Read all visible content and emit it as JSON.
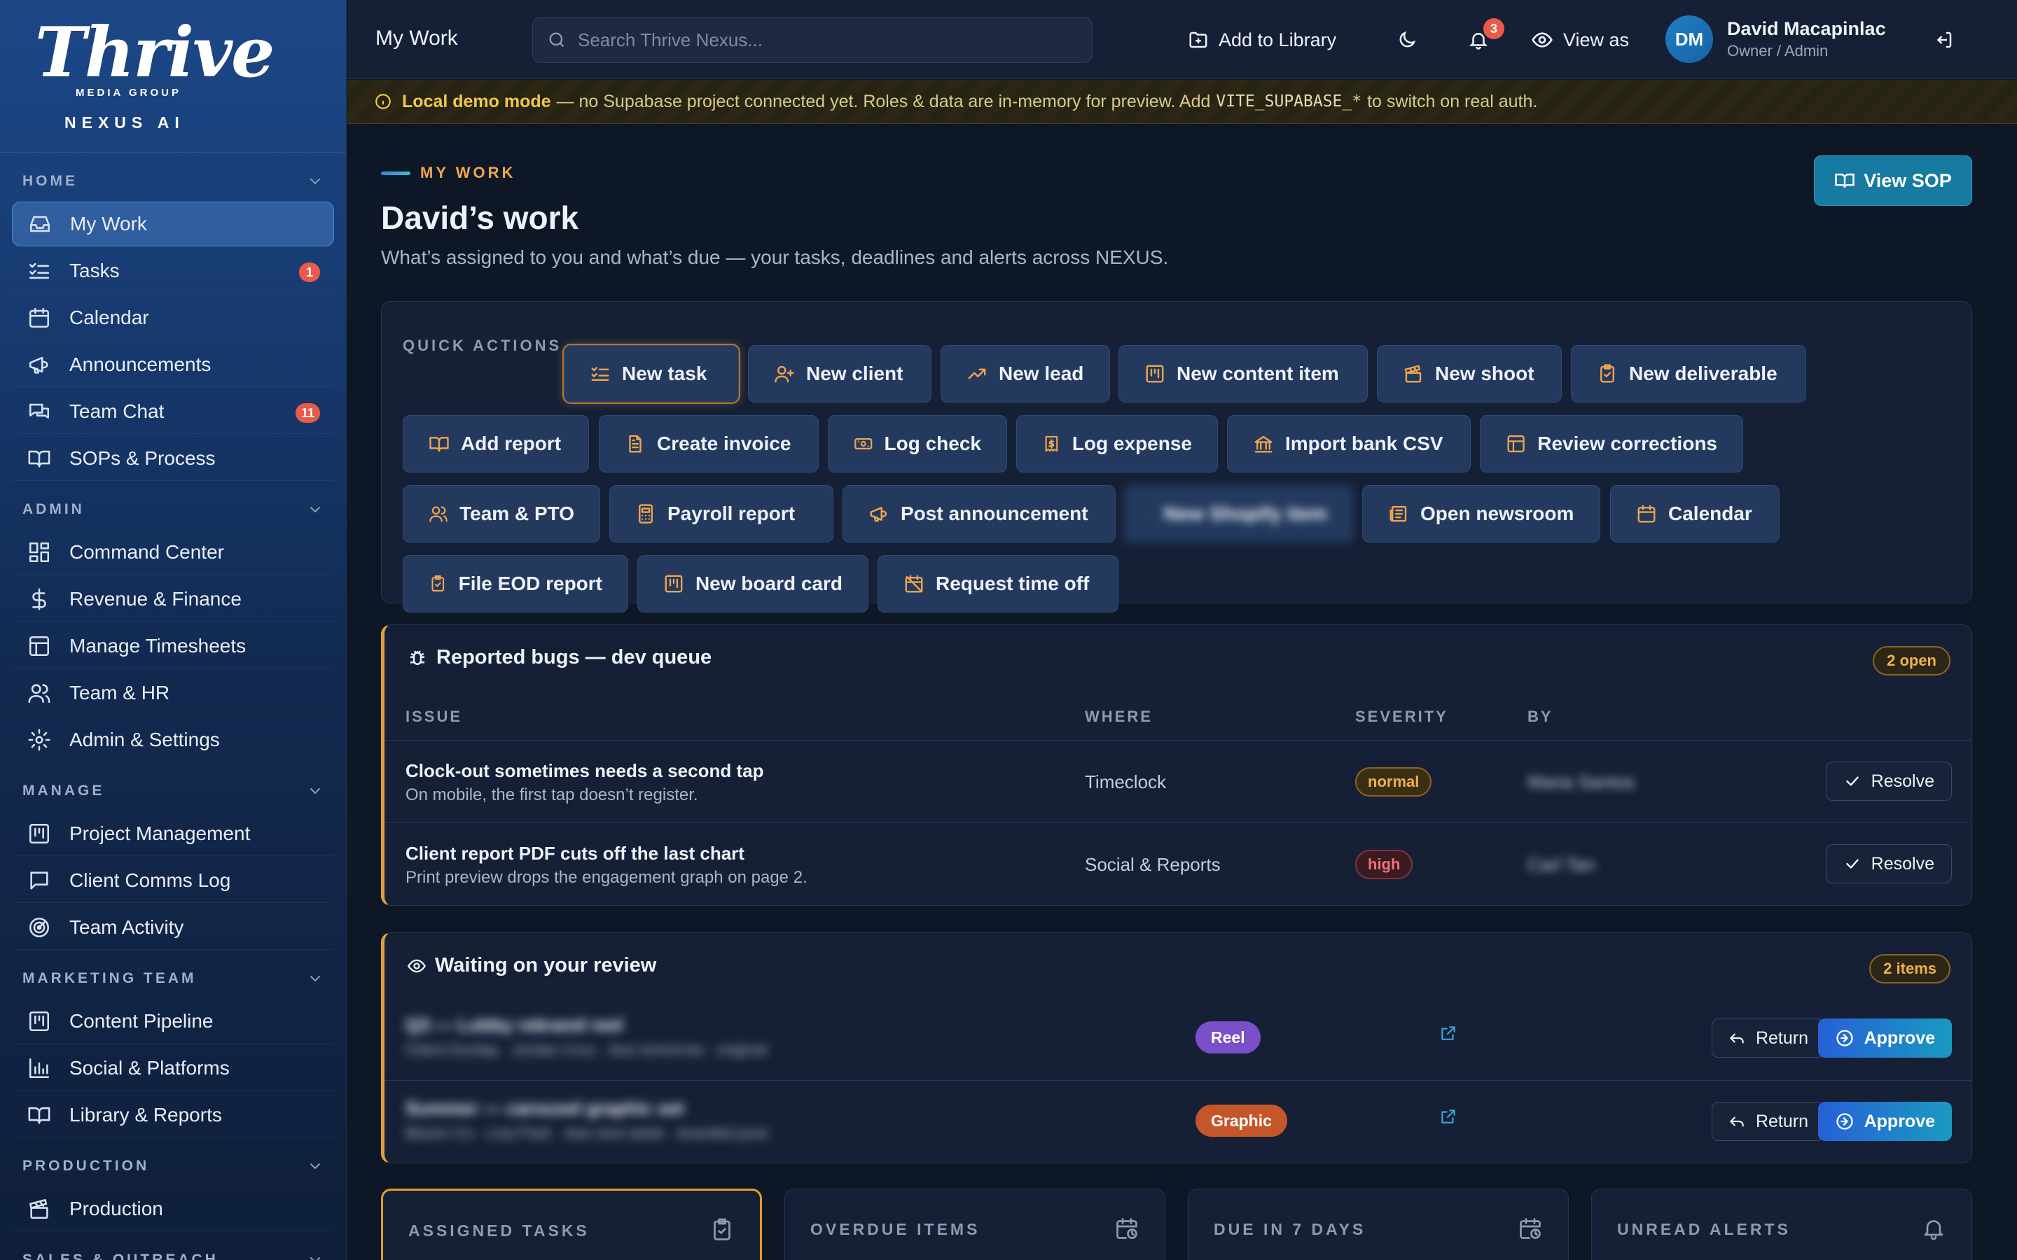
{
  "brand": {
    "script": "Thrive",
    "sub": "MEDIA GROUP",
    "product": "NEXUS AI"
  },
  "sidebar": {
    "sections": [
      {
        "label": "HOME",
        "items": [
          {
            "label": "My Work",
            "icon": "inbox-icon",
            "active": true
          },
          {
            "label": "Tasks",
            "icon": "list-check-icon",
            "badge": "1"
          },
          {
            "label": "Calendar",
            "icon": "calendar-icon"
          },
          {
            "label": "Announcements",
            "icon": "megaphone-icon"
          },
          {
            "label": "Team Chat",
            "icon": "chat-icon",
            "badge": "11"
          },
          {
            "label": "SOPs & Process",
            "icon": "book-icon"
          }
        ]
      },
      {
        "label": "ADMIN",
        "items": [
          {
            "label": "Command Center",
            "icon": "grid-icon"
          },
          {
            "label": "Revenue & Finance",
            "icon": "dollar-icon"
          },
          {
            "label": "Manage Timesheets",
            "icon": "table-icon"
          },
          {
            "label": "Team & HR",
            "icon": "users-icon"
          },
          {
            "label": "Admin & Settings",
            "icon": "gear-icon"
          }
        ]
      },
      {
        "label": "MANAGE",
        "items": [
          {
            "label": "Project Management",
            "icon": "kanban-icon"
          },
          {
            "label": "Client Comms Log",
            "icon": "message-square-icon"
          },
          {
            "label": "Team Activity",
            "icon": "radar-icon"
          }
        ]
      },
      {
        "label": "MARKETING TEAM",
        "items": [
          {
            "label": "Content Pipeline",
            "icon": "kanban-icon"
          },
          {
            "label": "Social & Platforms",
            "icon": "bar-chart-icon"
          },
          {
            "label": "Library & Reports",
            "icon": "book-icon"
          }
        ]
      },
      {
        "label": "PRODUCTION",
        "items": [
          {
            "label": "Production",
            "icon": "clapperboard-icon"
          }
        ]
      },
      {
        "label": "SALES & OUTREACH",
        "items": []
      }
    ]
  },
  "topbar": {
    "page": "My Work",
    "search_placeholder": "Search Thrive Nexus...",
    "add_library": "Add to Library",
    "notif_count": "3",
    "view_as": "View as",
    "user": {
      "initials": "DM",
      "name": "David Macapinlac",
      "role": "Owner / Admin"
    }
  },
  "banner": {
    "strong": "Local demo mode",
    "text": "— no Supabase project connected yet. Roles & data are in-memory for preview. Add",
    "code": "VITE_SUPABASE_*",
    "tail": "to switch on real auth."
  },
  "header": {
    "eyebrow": "MY WORK",
    "title": "David’s work",
    "subtitle": "What’s assigned to you and what’s due — your tasks, deadlines and alerts across NEXUS.",
    "sop_button": "View SOP"
  },
  "quick_actions": {
    "label": "QUICK ACTIONS",
    "items": [
      {
        "label": "New task",
        "icon": "list-check-icon"
      },
      {
        "label": "New client",
        "icon": "user-plus-icon"
      },
      {
        "label": "New lead",
        "icon": "trending-up-icon"
      },
      {
        "label": "New content item",
        "icon": "kanban-icon"
      },
      {
        "label": "New shoot",
        "icon": "clapperboard-icon"
      },
      {
        "label": "New deliverable",
        "icon": "clipboard-check-icon"
      },
      {
        "label": "Add report",
        "icon": "book-open-icon"
      },
      {
        "label": "Create invoice",
        "icon": "file-text-icon"
      },
      {
        "label": "Log check",
        "icon": "banknote-icon"
      },
      {
        "label": "Log expense",
        "icon": "receipt-dollar-icon"
      },
      {
        "label": "Import bank CSV",
        "icon": "bank-icon"
      },
      {
        "label": "Review corrections",
        "icon": "table-icon"
      },
      {
        "label": "Team & PTO",
        "icon": "users-icon"
      },
      {
        "label": "Payroll report",
        "icon": "calculator-icon"
      },
      {
        "label": "Post announcement",
        "icon": "megaphone-icon"
      },
      {
        "label": "New Shopify item",
        "icon": "circle-icon"
      },
      {
        "label": "Open newsroom",
        "icon": "newspaper-icon"
      },
      {
        "label": "Calendar",
        "icon": "calendar-icon"
      },
      {
        "label": "File EOD report",
        "icon": "clipboard-check-icon"
      },
      {
        "label": "New board card",
        "icon": "kanban-icon"
      },
      {
        "label": "Request time off",
        "icon": "calendar-off-icon"
      }
    ]
  },
  "bugs": {
    "title": "Reported bugs — dev queue",
    "count": "2 open",
    "columns": [
      "ISSUE",
      "WHERE",
      "SEVERITY",
      "BY"
    ],
    "rows": [
      {
        "title": "Clock-out sometimes needs a second tap",
        "desc": "On mobile, the first tap doesn’t register.",
        "where": "Timeclock",
        "severity": "normal",
        "by": "Maria Santos",
        "action": "Resolve"
      },
      {
        "title": "Client report PDF cuts off the last chart",
        "desc": "Print preview drops the engagement graph on page 2.",
        "where": "Social & Reports",
        "severity": "high",
        "by": "Carl Tan",
        "action": "Resolve"
      }
    ]
  },
  "review": {
    "title": "Waiting on your review",
    "count": "2 items",
    "rows": [
      {
        "title": "Q3 — Lobby rebrand reel",
        "desc": "Client Dunlap · Jordan Cruz · due tomorrow · original",
        "tag": "Reel",
        "return": "Return",
        "approve": "Approve"
      },
      {
        "title": "Summer — carousel graphic set",
        "desc": "Bloom Co · Lisa Park · due next week · branded post",
        "tag": "Graphic",
        "return": "Return",
        "approve": "Approve"
      }
    ]
  },
  "stats": [
    {
      "label": "ASSIGNED TASKS",
      "icon": "clipboard-check-icon"
    },
    {
      "label": "OVERDUE ITEMS",
      "icon": "calendar-clock-icon"
    },
    {
      "label": "DUE IN 7 DAYS",
      "icon": "calendar-clock-icon"
    },
    {
      "label": "UNREAD ALERTS",
      "icon": "bell-icon"
    }
  ],
  "colors": {
    "accent": "#f0a64a",
    "primary": "#177aa0",
    "badge": "#ea5a4a"
  }
}
